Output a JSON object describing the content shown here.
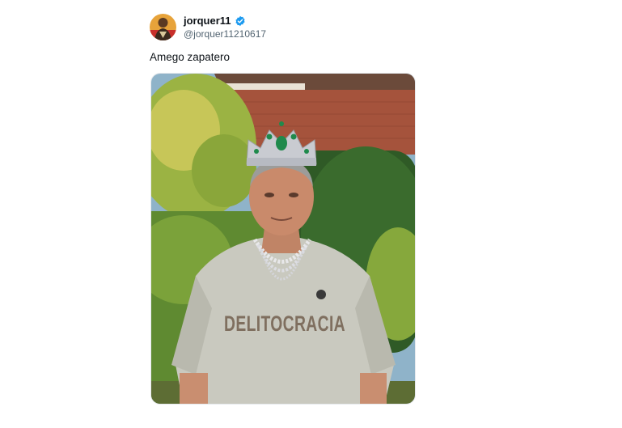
{
  "tweet": {
    "display_name": "jorquer11",
    "handle": "@jorquer11210617",
    "text": "Amego zapatero",
    "verified": true,
    "avatar_icon": "avatar-image",
    "media": {
      "shirt_text": "DELITOCRACIA",
      "icon": "photo-man-with-crown"
    }
  },
  "colors": {
    "verified_blue": "#1d9bf0",
    "text_primary": "#0f1419",
    "text_secondary": "#536471"
  }
}
